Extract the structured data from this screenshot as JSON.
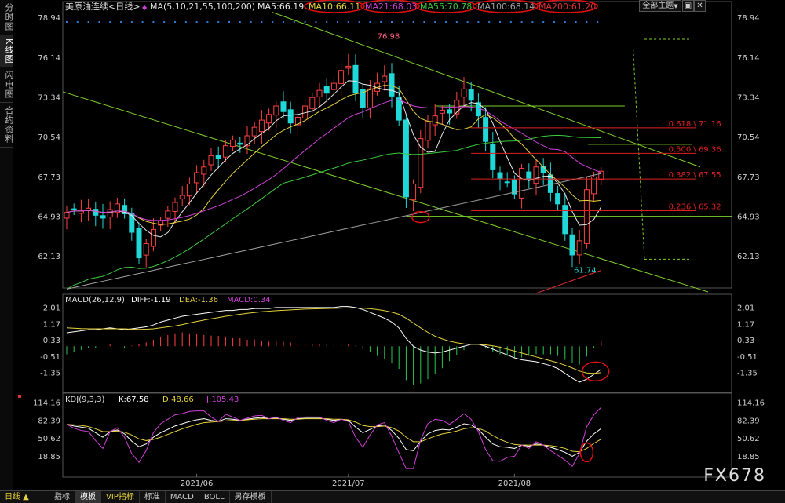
{
  "sidebar": {
    "tabs": [
      "分时图",
      "K线图",
      "闪电图",
      "合约资料"
    ]
  },
  "header": {
    "instrument": "美原油连续",
    "period": "<日线>",
    "ma_label": "MA(5,10,21,55,100,200)",
    "ma_values": [
      {
        "text": "MA5:66.19",
        "color": "#e8e8e8"
      },
      {
        "text": "MA10:66.11",
        "color": "#e6d23c"
      },
      {
        "text": "MA21:68.03",
        "color": "#d040d8"
      },
      {
        "text": "MA55:70.78",
        "color": "#3cc83c"
      },
      {
        "text": "MA100:68.14",
        "color": "#a0a0a0"
      },
      {
        "text": "MA200:61.20",
        "color": "#e03030"
      }
    ],
    "theme_select": "全部主题",
    "dropdown_glyph": "▼",
    "zoom_glyph": "▣",
    "close_glyph": "✕"
  },
  "footer": {
    "tabs": [
      "日线 ▲",
      "指标",
      "模板",
      "VIP指标",
      "标准",
      "MACD",
      "BOLL",
      "另存模板"
    ],
    "active": 2
  },
  "watermark": "FX678",
  "colors": {
    "up": "#ff4040",
    "down": "#20d8d8",
    "ma5": "#e8e8e8",
    "ma10": "#e6d23c",
    "ma21": "#d040d8",
    "ma55": "#3cc83c",
    "ma100": "#a0a0a0",
    "ma200": "#e03030",
    "channel": "#7ecf2a",
    "fib": "#e02020"
  },
  "chart_data": [
    {
      "type": "candlestick",
      "title": "美原油连续 日线",
      "y_ticks": [
        78.94,
        76.14,
        73.34,
        70.54,
        67.73,
        64.93,
        62.13
      ],
      "ylim": [
        59.6,
        79.5
      ],
      "x_labels": [
        {
          "label": "2021/06",
          "index": 18
        },
        {
          "label": "2021/07",
          "index": 39
        },
        {
          "label": "2021/08",
          "index": 62
        }
      ],
      "close": [
        65.2,
        65.4,
        65.3,
        65.5,
        65.0,
        64.8,
        65.4,
        65.8,
        65.1,
        63.8,
        62.0,
        63.0,
        64.0,
        64.6,
        65.3,
        65.9,
        66.4,
        67.2,
        68.0,
        68.4,
        69.2,
        69.0,
        69.9,
        70.3,
        70.0,
        70.6,
        71.2,
        71.7,
        72.1,
        72.7,
        72.3,
        71.5,
        71.9,
        72.7,
        73.3,
        73.8,
        73.6,
        74.3,
        75.2,
        75.5,
        73.6,
        72.6,
        73.9,
        74.3,
        74.8,
        73.4,
        71.7,
        66.3,
        67.2,
        70.4,
        71.6,
        72.0,
        72.4,
        72.2,
        73.1,
        73.9,
        73.1,
        72.0,
        70.2,
        68.2,
        67.6,
        67.3,
        66.5,
        68.3,
        67.5,
        68.4,
        68.0,
        66.6,
        65.8,
        63.7,
        62.2,
        63.2,
        66.8,
        67.7,
        68.1
      ],
      "labels": [
        {
          "text": "76.98",
          "index": 43,
          "value": 76.98
        },
        {
          "text": "61.74",
          "index": 70,
          "value": 61.74
        }
      ],
      "fibonacci": [
        {
          "label": "0.618 \\ 71.16",
          "value": 71.16
        },
        {
          "label": "0.500 \\ 69.36",
          "value": 69.36
        },
        {
          "label": "0.382 \\ 67.55",
          "value": 67.55
        },
        {
          "label": "0.236 \\ 65.32",
          "value": 65.32
        }
      ],
      "support_level": 64.93
    },
    {
      "type": "line",
      "title": "MACD",
      "header": "MACD(26,12,9)",
      "readouts": [
        {
          "text": "DIFF:-1.19",
          "color": "#ffffff"
        },
        {
          "text": "DEA:-1.36",
          "color": "#e6d23c"
        },
        {
          "text": "MACD:0.34",
          "color": "#d040d8"
        }
      ],
      "y_ticks": [
        2.01,
        1.17,
        0.33,
        -0.51,
        -1.35
      ],
      "ylim": [
        -2.3,
        2.4
      ],
      "series": [
        {
          "name": "DIFF",
          "values": [
            0.7,
            0.75,
            0.8,
            0.85,
            0.85,
            0.9,
            0.95,
            0.9,
            0.85,
            0.9,
            0.95,
            1.0,
            1.1,
            1.25,
            1.35,
            1.45,
            1.55,
            1.6,
            1.65,
            1.7,
            1.75,
            1.8,
            1.85,
            1.85,
            1.9,
            1.9,
            1.95,
            1.95,
            1.95,
            2.0,
            2.0,
            2.0,
            2.0,
            2.0,
            2.0,
            2.0,
            2.0,
            2.0,
            2.05,
            2.05,
            2.0,
            1.9,
            1.75,
            1.6,
            1.45,
            1.25,
            0.95,
            0.4,
            0.0,
            -0.2,
            -0.3,
            -0.35,
            -0.3,
            -0.2,
            -0.1,
            0.0,
            0.1,
            0.1,
            0.0,
            -0.15,
            -0.3,
            -0.45,
            -0.6,
            -0.7,
            -0.75,
            -0.8,
            -0.9,
            -1.0,
            -1.15,
            -1.4,
            -1.65,
            -1.85,
            -1.7,
            -1.45,
            -1.19
          ]
        },
        {
          "name": "DEA",
          "values": [
            0.95,
            0.93,
            0.91,
            0.9,
            0.9,
            0.9,
            0.9,
            0.9,
            0.9,
            0.88,
            0.87,
            0.88,
            0.9,
            0.95,
            1.0,
            1.05,
            1.12,
            1.2,
            1.28,
            1.35,
            1.42,
            1.48,
            1.55,
            1.6,
            1.65,
            1.7,
            1.74,
            1.78,
            1.81,
            1.84,
            1.86,
            1.88,
            1.9,
            1.92,
            1.93,
            1.94,
            1.95,
            1.96,
            1.97,
            1.98,
            1.98,
            1.97,
            1.94,
            1.9,
            1.84,
            1.76,
            1.65,
            1.45,
            1.2,
            0.95,
            0.72,
            0.52,
            0.38,
            0.26,
            0.18,
            0.12,
            0.1,
            0.1,
            0.07,
            0.02,
            -0.05,
            -0.15,
            -0.25,
            -0.35,
            -0.45,
            -0.55,
            -0.65,
            -0.75,
            -0.85,
            -0.98,
            -1.12,
            -1.28,
            -1.38,
            -1.4,
            -1.36
          ]
        },
        {
          "name": "MACD",
          "values": [
            -0.5,
            -0.36,
            -0.22,
            -0.1,
            -0.1,
            0.0,
            0.1,
            0.0,
            -0.1,
            0.04,
            0.16,
            0.24,
            0.4,
            0.6,
            0.7,
            0.8,
            0.86,
            0.8,
            0.74,
            0.7,
            0.66,
            0.64,
            0.6,
            0.5,
            0.5,
            0.4,
            0.42,
            0.34,
            0.28,
            0.32,
            0.28,
            0.24,
            0.2,
            0.16,
            0.14,
            0.12,
            0.1,
            0.08,
            0.16,
            0.14,
            0.04,
            -0.14,
            -0.38,
            -0.6,
            -0.78,
            -1.02,
            -1.4,
            -2.1,
            -2.4,
            -2.3,
            -2.04,
            -1.74,
            -1.36,
            -0.92,
            -0.56,
            -0.24,
            0.0,
            0.0,
            -0.14,
            -0.34,
            -0.5,
            -0.6,
            -0.7,
            -0.7,
            -0.6,
            -0.5,
            -0.5,
            -0.5,
            -0.6,
            -0.84,
            -1.06,
            -1.14,
            -0.64,
            -0.1,
            0.34
          ]
        }
      ]
    },
    {
      "type": "line",
      "title": "KDJ",
      "header": "KDJ(9,3,3)",
      "readouts": [
        {
          "text": "K:67.58",
          "color": "#ffffff"
        },
        {
          "text": "D:48.66",
          "color": "#e6d23c"
        },
        {
          "text": "J:105.43",
          "color": "#d040d8"
        }
      ],
      "y_ticks": [
        114.16,
        82.39,
        50.62,
        18.85
      ],
      "ylim": [
        -8,
        118
      ],
      "series": [
        {
          "name": "K",
          "values": [
            75,
            72,
            70,
            68,
            60,
            52,
            62,
            65,
            58,
            45,
            35,
            40,
            52,
            60,
            66,
            72,
            76,
            80,
            83,
            85,
            82,
            80,
            85,
            84,
            82,
            84,
            86,
            87,
            85,
            86,
            84,
            82,
            85,
            86,
            86,
            86,
            84,
            82,
            84,
            82,
            70,
            60,
            66,
            72,
            74,
            64,
            50,
            30,
            28,
            45,
            58,
            64,
            66,
            65,
            70,
            76,
            74,
            66,
            52,
            40,
            35,
            34,
            32,
            38,
            36,
            40,
            38,
            34,
            30,
            25,
            18,
            25,
            45,
            58,
            67.58
          ]
        },
        {
          "name": "D",
          "values": [
            75,
            74,
            73,
            71,
            67,
            62,
            62,
            63,
            61,
            56,
            49,
            46,
            48,
            52,
            57,
            62,
            67,
            71,
            75,
            78,
            79,
            80,
            81,
            82,
            82,
            83,
            84,
            85,
            85,
            85,
            85,
            84,
            84,
            85,
            85,
            85,
            85,
            84,
            84,
            83,
            79,
            73,
            71,
            71,
            72,
            69,
            63,
            52,
            44,
            44,
            49,
            54,
            58,
            60,
            63,
            67,
            69,
            68,
            63,
            55,
            48,
            43,
            39,
            38,
            38,
            38,
            38,
            37,
            35,
            32,
            27,
            26,
            32,
            41,
            48.66
          ]
        },
        {
          "name": "J",
          "values": [
            75,
            68,
            64,
            62,
            46,
            32,
            62,
            69,
            52,
            23,
            7,
            28,
            60,
            76,
            84,
            92,
            94,
            98,
            99,
            99,
            88,
            80,
            93,
            88,
            82,
            86,
            90,
            91,
            85,
            88,
            82,
            78,
            87,
            88,
            88,
            88,
            82,
            78,
            84,
            80,
            52,
            34,
            56,
            74,
            78,
            54,
            24,
            -4,
            -4,
            47,
            76,
            84,
            82,
            75,
            84,
            94,
            84,
            62,
            30,
            10,
            9,
            16,
            18,
            38,
            32,
            44,
            38,
            28,
            20,
            11,
            0,
            23,
            71,
            92,
            105.43
          ]
        }
      ]
    }
  ]
}
